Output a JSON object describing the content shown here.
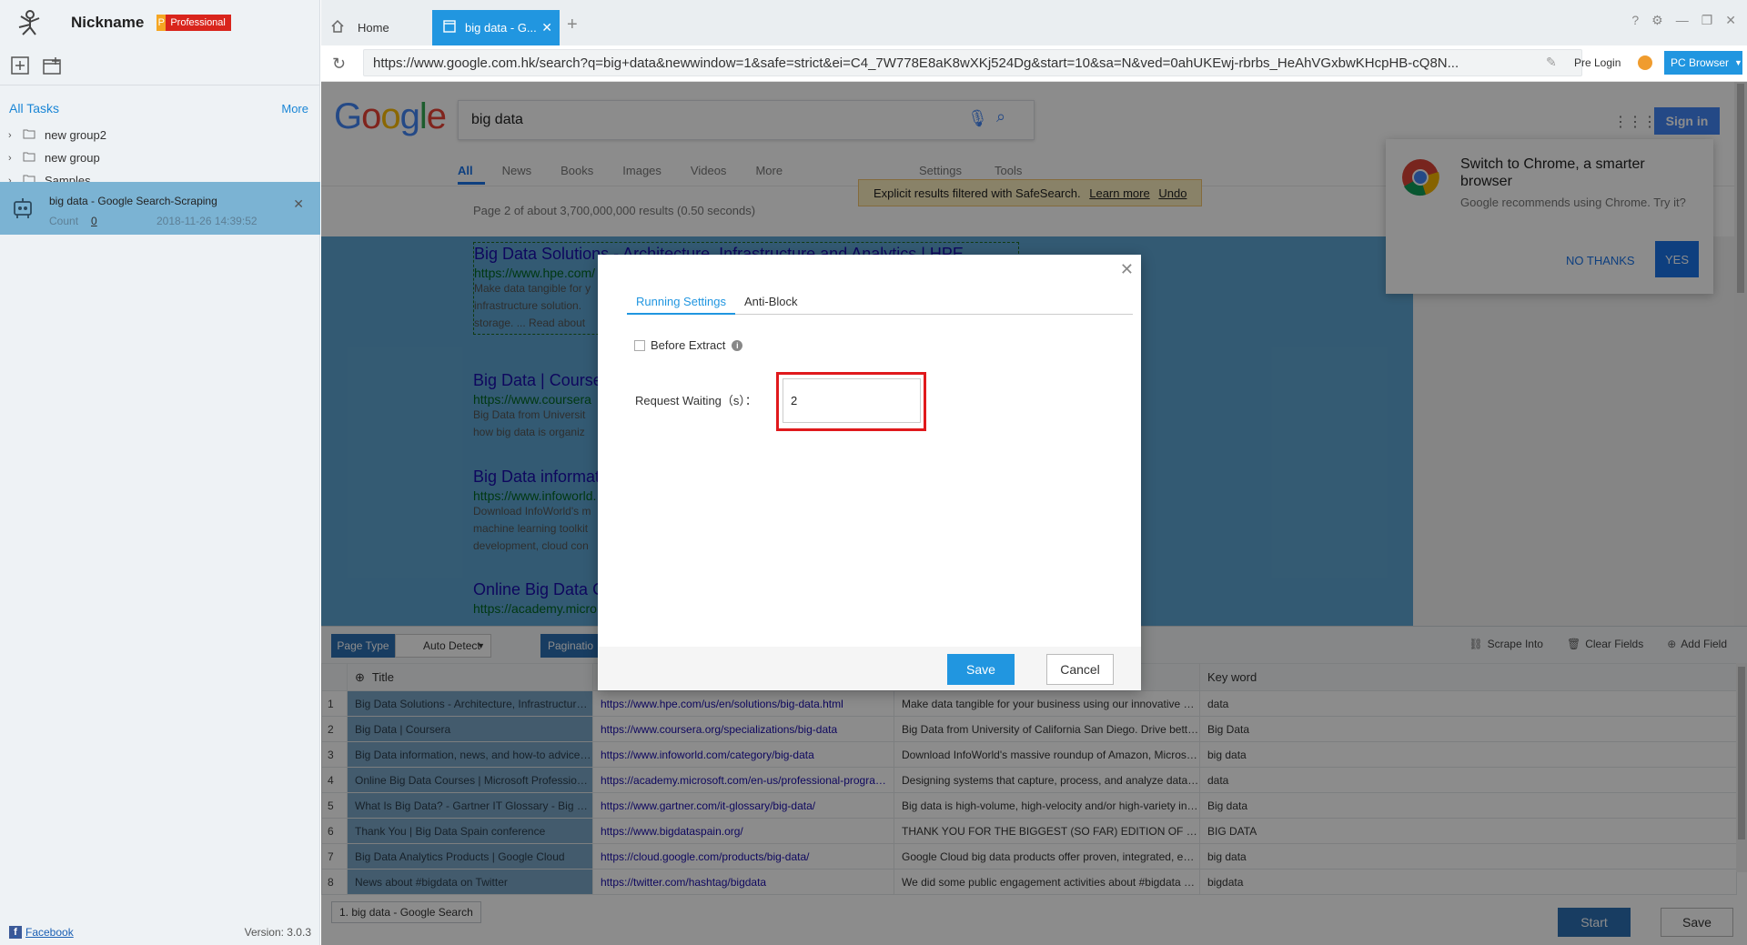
{
  "app": {
    "nickname": "Nickname",
    "plan_badge": "Professional",
    "plan_badge_prefix": "P",
    "version": "Version: 3.0.3",
    "facebook_link": "Facebook"
  },
  "sidebar": {
    "all_tasks": "All Tasks",
    "more": "More",
    "groups": [
      {
        "label": "new group2"
      },
      {
        "label": "new group"
      },
      {
        "label": "Samples"
      }
    ],
    "task": {
      "name": "big data - Google Search-Scraping",
      "count_label": "Count",
      "count": "0",
      "date": "2018-11-26 14:39:52"
    }
  },
  "tabs": {
    "home": "Home",
    "active": "big data - G..."
  },
  "addressbar": {
    "url": "https://www.google.com.hk/search?q=big+data&newwindow=1&safe=strict&ei=C4_7W778E8aK8wXKj524Dg&start=10&sa=N&ved=0ahUKEwj-rbrbs_HeAhVGxbwKHcpHB-cQ8N...",
    "pre_login": "Pre Login",
    "browser_mode": "PC Browser"
  },
  "google": {
    "query": "big data",
    "sign_in": "Sign in",
    "tabs": [
      "All",
      "News",
      "Books",
      "Images",
      "Videos",
      "More"
    ],
    "tabs_right": [
      "Settings",
      "Tools"
    ],
    "safe_text": "Explicit results filtered with SafeSearch.",
    "safe_learn": "Learn more",
    "safe_undo": "Undo",
    "stats": "Page 2 of about 3,700,000,000 results (0.50 seconds)",
    "results": [
      {
        "title": "Big Data Solutions - Architecture, Infrastructure and Analytics | HPE",
        "url": "https://www.hpe.com/",
        "snippet": [
          "Make data tangible for y",
          "infrastructure solution.",
          "storage. ... Read about"
        ]
      },
      {
        "title": "Big Data | Course",
        "url": "https://www.coursera",
        "snippet": [
          "Big Data from Universit",
          "how big data is organiz"
        ]
      },
      {
        "title": "Big Data informat",
        "url": "https://www.infoworld.",
        "snippet": [
          "Download InfoWorld's m",
          "machine learning toolkit",
          "development, cloud con"
        ]
      },
      {
        "title": "Online Big Data C",
        "url": "https://academy.micro",
        "snippet": []
      }
    ],
    "promo": {
      "title": "Switch to Chrome, a smarter browser",
      "subtitle": "Google recommends using Chrome. Try it?",
      "no_thanks": "NO THANKS",
      "yes": "YES"
    }
  },
  "datapanel": {
    "page_type_label": "Page Type",
    "page_type_value": "Auto Detect",
    "pagination_label": "Paginatio",
    "actions": {
      "scrape_into": "Scrape Into",
      "clear_fields": "Clear Fields",
      "add_field": "Add Field"
    },
    "columns": [
      "Title",
      "",
      "",
      "Key word"
    ],
    "rows": [
      {
        "idx": "1",
        "title": "Big Data Solutions - Architecture, Infrastructure and Analy...",
        "link": "https://www.hpe.com/us/en/solutions/big-data.html",
        "desc": "Make data tangible for your business using our innovative software, serv...",
        "key": "data"
      },
      {
        "idx": "2",
        "title": "Big Data | Coursera",
        "link": "https://www.coursera.org/specializations/big-data",
        "desc": "Big Data from University of California San Diego. Drive better business d...",
        "key": "Big Data"
      },
      {
        "idx": "3",
        "title": "Big Data information, news, and how-to advice | InfoWorld",
        "link": "https://www.infoworld.com/category/big-data",
        "desc": "Download InfoWorld's massive roundup of Amazon, Microsoft, Databrick...",
        "key": "big data"
      },
      {
        "idx": "4",
        "title": "Online Big Data Courses | Microsoft Professional Program",
        "link": "https://academy.microsoft.com/en-us/professional-program/tracks/big-d...",
        "desc": "Designing systems that capture, process, and analyze data is critical for ...",
        "key": "data"
      },
      {
        "idx": "5",
        "title": "What Is Big Data? - Gartner IT Glossary - Big Data",
        "link": "https://www.gartner.com/it-glossary/big-data/",
        "desc": "Big data is high-volume, high-velocity and/or high-variety information as...",
        "key": "Big data"
      },
      {
        "idx": "6",
        "title": "Thank You | Big Data Spain conference",
        "link": "https://www.bigdataspain.org/",
        "desc": "THANK YOU FOR THE BIGGEST (SO FAR) EDITION OF BIG DATA SPAI...",
        "key": "BIG DATA"
      },
      {
        "idx": "7",
        "title": "Big Data Analytics Products | Google Cloud",
        "link": "https://cloud.google.com/products/big-data/",
        "desc": "Google Cloud big data products offer proven, integrated, end-to-end pro...",
        "key": "big data"
      },
      {
        "idx": "8",
        "title": "News about #bigdata on Twitter",
        "link": "https://twitter.com/hashtag/bigdata",
        "desc": "We did some public engagement activities about #bigdata and discover...",
        "key": "bigdata"
      }
    ],
    "page_tab": "1. big data - Google Search",
    "start": "Start",
    "save": "Save"
  },
  "modal": {
    "tabs": [
      "Running Settings",
      "Anti-Block"
    ],
    "before_extract": "Before Extract",
    "request_waiting_label": "Request Waiting（s）：",
    "request_waiting_value": "2",
    "save": "Save",
    "cancel": "Cancel"
  },
  "colors": {
    "accent": "#2196e0",
    "highlight": "#e0191c",
    "sidebar_task": "#7bb3d3"
  }
}
